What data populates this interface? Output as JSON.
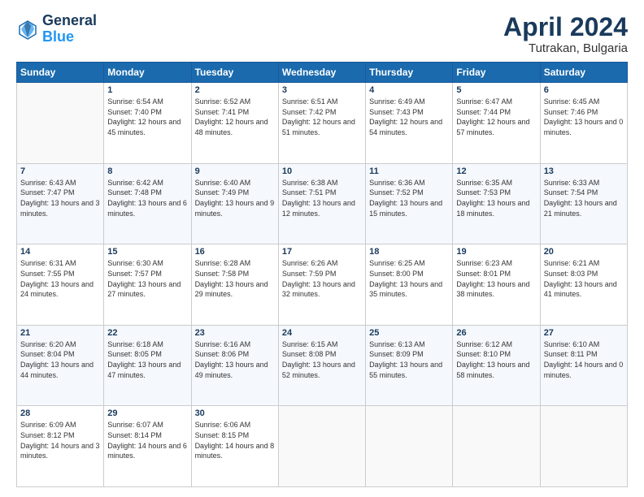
{
  "header": {
    "logo_line1": "General",
    "logo_line2": "Blue",
    "month_title": "April 2024",
    "location": "Tutrakan, Bulgaria"
  },
  "days_of_week": [
    "Sunday",
    "Monday",
    "Tuesday",
    "Wednesday",
    "Thursday",
    "Friday",
    "Saturday"
  ],
  "weeks": [
    [
      {
        "day": "",
        "sunrise": "",
        "sunset": "",
        "daylight": ""
      },
      {
        "day": "1",
        "sunrise": "Sunrise: 6:54 AM",
        "sunset": "Sunset: 7:40 PM",
        "daylight": "Daylight: 12 hours and 45 minutes."
      },
      {
        "day": "2",
        "sunrise": "Sunrise: 6:52 AM",
        "sunset": "Sunset: 7:41 PM",
        "daylight": "Daylight: 12 hours and 48 minutes."
      },
      {
        "day": "3",
        "sunrise": "Sunrise: 6:51 AM",
        "sunset": "Sunset: 7:42 PM",
        "daylight": "Daylight: 12 hours and 51 minutes."
      },
      {
        "day": "4",
        "sunrise": "Sunrise: 6:49 AM",
        "sunset": "Sunset: 7:43 PM",
        "daylight": "Daylight: 12 hours and 54 minutes."
      },
      {
        "day": "5",
        "sunrise": "Sunrise: 6:47 AM",
        "sunset": "Sunset: 7:44 PM",
        "daylight": "Daylight: 12 hours and 57 minutes."
      },
      {
        "day": "6",
        "sunrise": "Sunrise: 6:45 AM",
        "sunset": "Sunset: 7:46 PM",
        "daylight": "Daylight: 13 hours and 0 minutes."
      }
    ],
    [
      {
        "day": "7",
        "sunrise": "Sunrise: 6:43 AM",
        "sunset": "Sunset: 7:47 PM",
        "daylight": "Daylight: 13 hours and 3 minutes."
      },
      {
        "day": "8",
        "sunrise": "Sunrise: 6:42 AM",
        "sunset": "Sunset: 7:48 PM",
        "daylight": "Daylight: 13 hours and 6 minutes."
      },
      {
        "day": "9",
        "sunrise": "Sunrise: 6:40 AM",
        "sunset": "Sunset: 7:49 PM",
        "daylight": "Daylight: 13 hours and 9 minutes."
      },
      {
        "day": "10",
        "sunrise": "Sunrise: 6:38 AM",
        "sunset": "Sunset: 7:51 PM",
        "daylight": "Daylight: 13 hours and 12 minutes."
      },
      {
        "day": "11",
        "sunrise": "Sunrise: 6:36 AM",
        "sunset": "Sunset: 7:52 PM",
        "daylight": "Daylight: 13 hours and 15 minutes."
      },
      {
        "day": "12",
        "sunrise": "Sunrise: 6:35 AM",
        "sunset": "Sunset: 7:53 PM",
        "daylight": "Daylight: 13 hours and 18 minutes."
      },
      {
        "day": "13",
        "sunrise": "Sunrise: 6:33 AM",
        "sunset": "Sunset: 7:54 PM",
        "daylight": "Daylight: 13 hours and 21 minutes."
      }
    ],
    [
      {
        "day": "14",
        "sunrise": "Sunrise: 6:31 AM",
        "sunset": "Sunset: 7:55 PM",
        "daylight": "Daylight: 13 hours and 24 minutes."
      },
      {
        "day": "15",
        "sunrise": "Sunrise: 6:30 AM",
        "sunset": "Sunset: 7:57 PM",
        "daylight": "Daylight: 13 hours and 27 minutes."
      },
      {
        "day": "16",
        "sunrise": "Sunrise: 6:28 AM",
        "sunset": "Sunset: 7:58 PM",
        "daylight": "Daylight: 13 hours and 29 minutes."
      },
      {
        "day": "17",
        "sunrise": "Sunrise: 6:26 AM",
        "sunset": "Sunset: 7:59 PM",
        "daylight": "Daylight: 13 hours and 32 minutes."
      },
      {
        "day": "18",
        "sunrise": "Sunrise: 6:25 AM",
        "sunset": "Sunset: 8:00 PM",
        "daylight": "Daylight: 13 hours and 35 minutes."
      },
      {
        "day": "19",
        "sunrise": "Sunrise: 6:23 AM",
        "sunset": "Sunset: 8:01 PM",
        "daylight": "Daylight: 13 hours and 38 minutes."
      },
      {
        "day": "20",
        "sunrise": "Sunrise: 6:21 AM",
        "sunset": "Sunset: 8:03 PM",
        "daylight": "Daylight: 13 hours and 41 minutes."
      }
    ],
    [
      {
        "day": "21",
        "sunrise": "Sunrise: 6:20 AM",
        "sunset": "Sunset: 8:04 PM",
        "daylight": "Daylight: 13 hours and 44 minutes."
      },
      {
        "day": "22",
        "sunrise": "Sunrise: 6:18 AM",
        "sunset": "Sunset: 8:05 PM",
        "daylight": "Daylight: 13 hours and 47 minutes."
      },
      {
        "day": "23",
        "sunrise": "Sunrise: 6:16 AM",
        "sunset": "Sunset: 8:06 PM",
        "daylight": "Daylight: 13 hours and 49 minutes."
      },
      {
        "day": "24",
        "sunrise": "Sunrise: 6:15 AM",
        "sunset": "Sunset: 8:08 PM",
        "daylight": "Daylight: 13 hours and 52 minutes."
      },
      {
        "day": "25",
        "sunrise": "Sunrise: 6:13 AM",
        "sunset": "Sunset: 8:09 PM",
        "daylight": "Daylight: 13 hours and 55 minutes."
      },
      {
        "day": "26",
        "sunrise": "Sunrise: 6:12 AM",
        "sunset": "Sunset: 8:10 PM",
        "daylight": "Daylight: 13 hours and 58 minutes."
      },
      {
        "day": "27",
        "sunrise": "Sunrise: 6:10 AM",
        "sunset": "Sunset: 8:11 PM",
        "daylight": "Daylight: 14 hours and 0 minutes."
      }
    ],
    [
      {
        "day": "28",
        "sunrise": "Sunrise: 6:09 AM",
        "sunset": "Sunset: 8:12 PM",
        "daylight": "Daylight: 14 hours and 3 minutes."
      },
      {
        "day": "29",
        "sunrise": "Sunrise: 6:07 AM",
        "sunset": "Sunset: 8:14 PM",
        "daylight": "Daylight: 14 hours and 6 minutes."
      },
      {
        "day": "30",
        "sunrise": "Sunrise: 6:06 AM",
        "sunset": "Sunset: 8:15 PM",
        "daylight": "Daylight: 14 hours and 8 minutes."
      },
      {
        "day": "",
        "sunrise": "",
        "sunset": "",
        "daylight": ""
      },
      {
        "day": "",
        "sunrise": "",
        "sunset": "",
        "daylight": ""
      },
      {
        "day": "",
        "sunrise": "",
        "sunset": "",
        "daylight": ""
      },
      {
        "day": "",
        "sunrise": "",
        "sunset": "",
        "daylight": ""
      }
    ]
  ]
}
